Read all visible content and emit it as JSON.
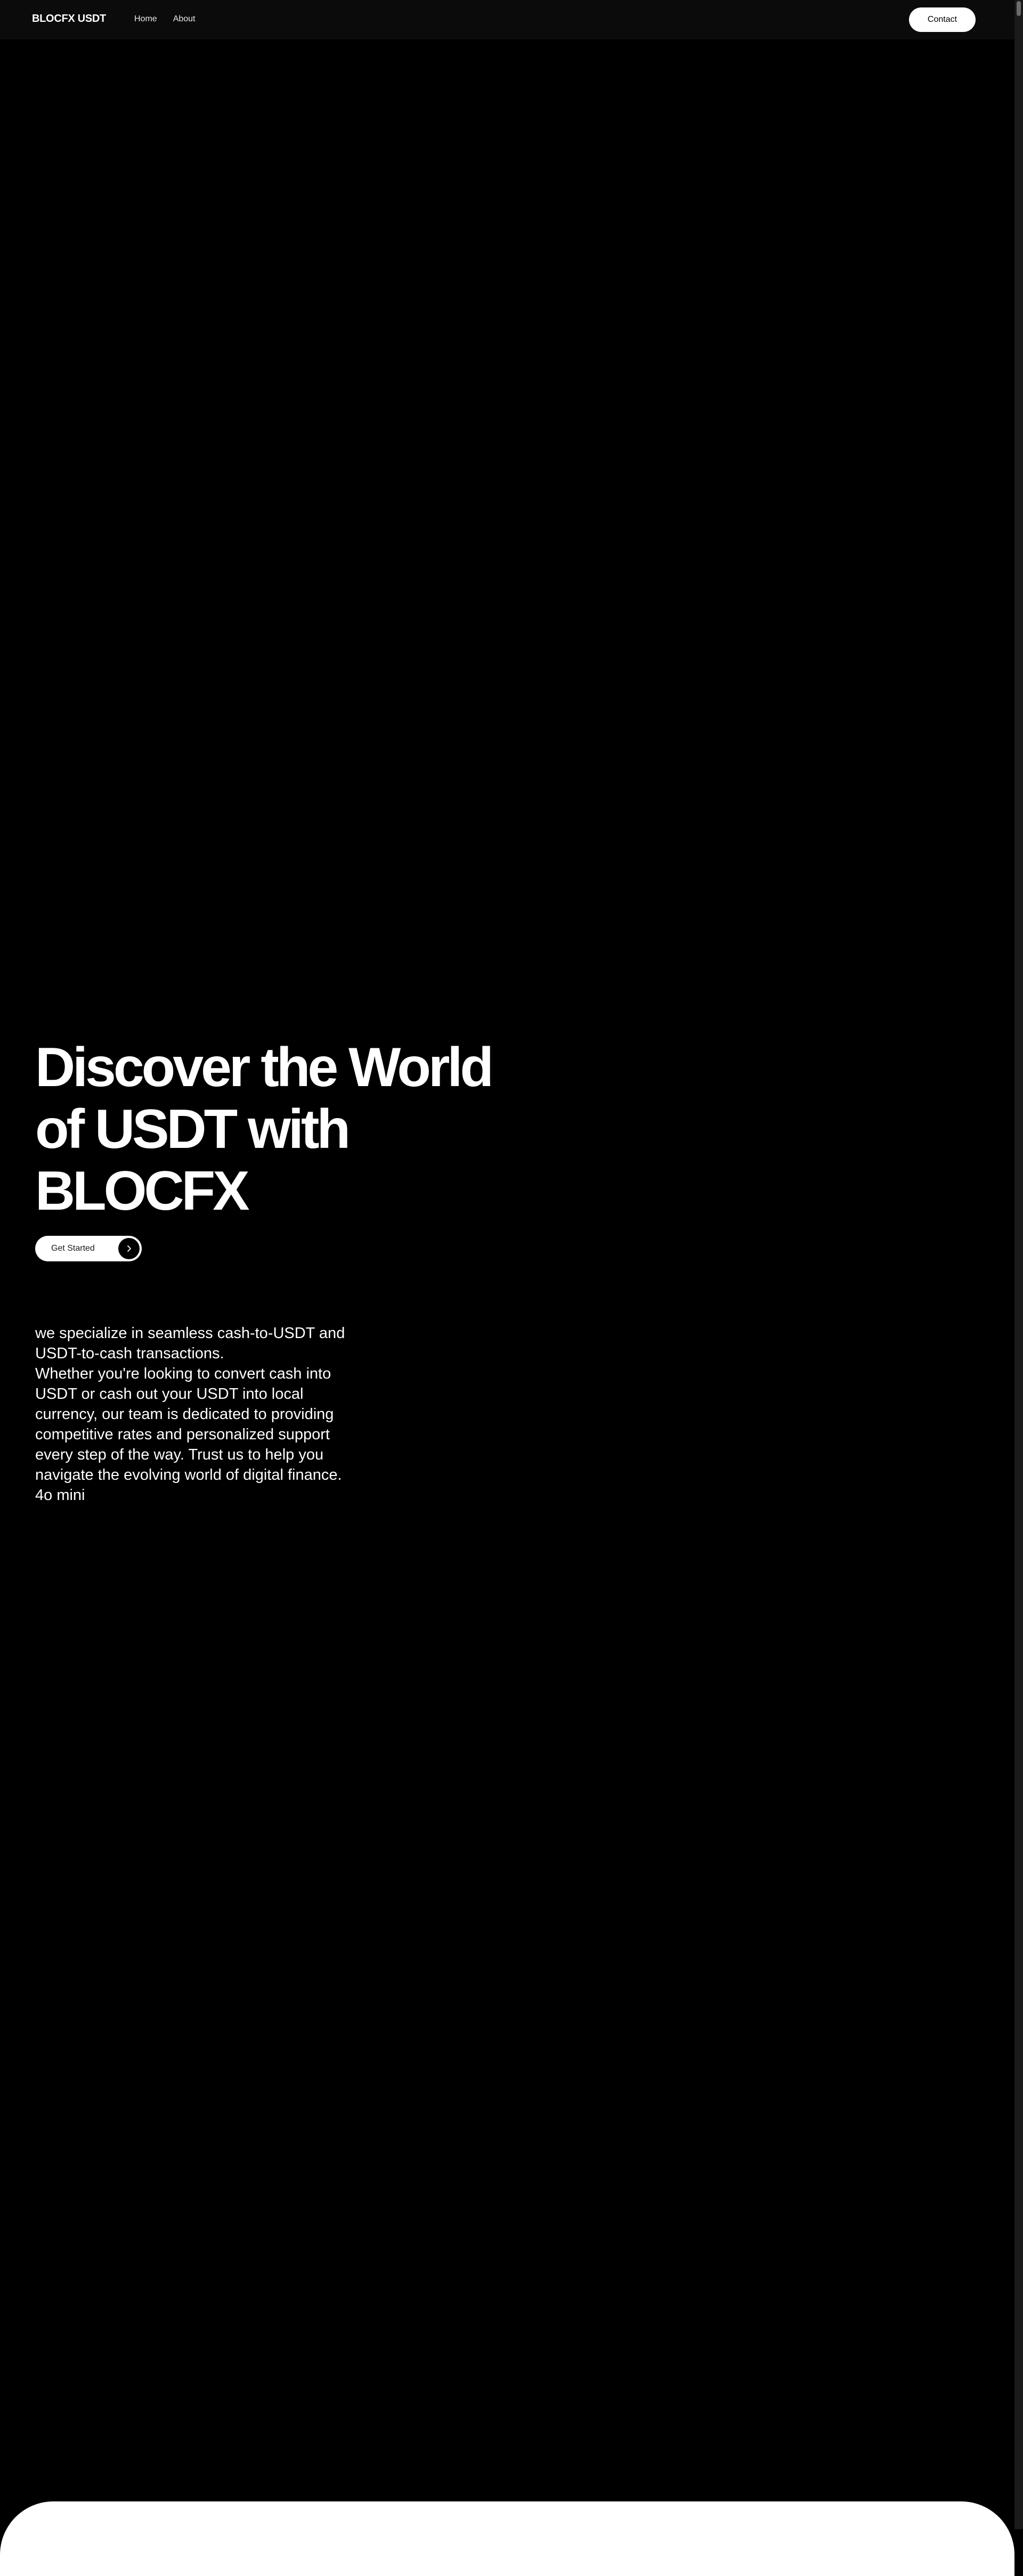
{
  "brand": {
    "logo": "BLOCFX USDT"
  },
  "nav": {
    "links": [
      "Home",
      "About"
    ],
    "contact_label": "Contact"
  },
  "hero": {
    "title_lines": [
      "Discover the World",
      "of USDT with",
      "BLOCFX"
    ],
    "cta_label": "Get Started",
    "cta_icon": "chevron-right-icon"
  },
  "intro": {
    "lines": [
      "we specialize in seamless cash-to-USDT and USDT-to-cash transactions.",
      "Whether you're looking to convert cash into USDT or cash out your USDT into local currency, our team is dedicated to providing competitive rates and personalized support every step of the way. Trust us to help you navigate the evolving world of digital finance.",
      "4o mini"
    ]
  },
  "colors": {
    "background": "#000000",
    "navbar": "#0b0b0b",
    "button": "#ffffff",
    "text": "#ffffff"
  }
}
